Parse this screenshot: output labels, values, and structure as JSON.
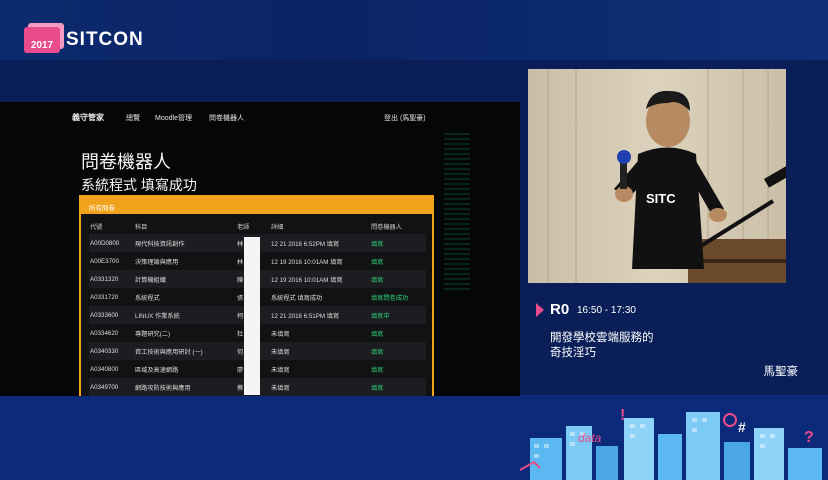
{
  "logo": {
    "year": "2017",
    "name": "SITCON"
  },
  "screen": {
    "nav": {
      "brand": "義守管家",
      "items": [
        "總覽",
        "Moodle管理",
        "問卷機器人"
      ],
      "logout": "登出 (馬聖豪)"
    },
    "heading": "問卷機器人",
    "subheading": "系統程式 填寫成功",
    "panel_title": "所有問卷",
    "columns": [
      "代號",
      "科目",
      "老師",
      "詳細",
      "問卷機器人"
    ],
    "rows": [
      {
        "code": "A00D0800",
        "subject": "現代科技資訊創作",
        "teacher": "林",
        "detail": "12 21 2016 6:52PM 填寫",
        "status": "填寫"
      },
      {
        "code": "A00E3700",
        "subject": "決策理論與應用",
        "teacher": "林",
        "detail": "12 19 2016 10:01AM 填寫",
        "status": "填寫"
      },
      {
        "code": "A0331320",
        "subject": "計算機組織",
        "teacher": "陳",
        "detail": "12 19 2016 10:01AM 填寫",
        "status": "填寫"
      },
      {
        "code": "A0331720",
        "subject": "系統程式",
        "teacher": "張",
        "detail": "系統程式 填寫成功",
        "status": "填寫問卷成功"
      },
      {
        "code": "A0333600",
        "subject": "LINUX 作業系統",
        "teacher": "柯",
        "detail": "12 21 2016 6:51PM 填寫",
        "status": "填寫中"
      },
      {
        "code": "A0334620",
        "subject": "專題研究(二)",
        "teacher": "杜",
        "detail": "未填寫",
        "status": "填寫"
      },
      {
        "code": "A0340330",
        "subject": "資工技術與應用研討 (一)",
        "teacher": "何",
        "detail": "未填寫",
        "status": "填寫"
      },
      {
        "code": "A0340800",
        "subject": "區域及高速網路",
        "teacher": "廖",
        "detail": "未填寫",
        "status": "填寫"
      },
      {
        "code": "A0349700",
        "subject": "網路攻防技術與應用",
        "teacher": "蔡",
        "detail": "未填寫",
        "status": "填寫"
      },
      {
        "code": "A93A0906",
        "subject": "職能與倫理",
        "teacher": "劉",
        "detail": "未填寫",
        "status": "填寫"
      }
    ]
  },
  "session": {
    "room": "R0",
    "time": "16:50 - 17:30",
    "title_line1": "開發學校雲端服務的",
    "title_line2": "奇技淫巧",
    "speaker": "馬聖豪"
  },
  "decoration": {
    "doodle_text": "data"
  },
  "colors": {
    "accent_pink": "#e94b8d",
    "panel_orange": "#f0a21a",
    "link_green": "#2fd17a",
    "background_blue": "#0a1f57"
  }
}
